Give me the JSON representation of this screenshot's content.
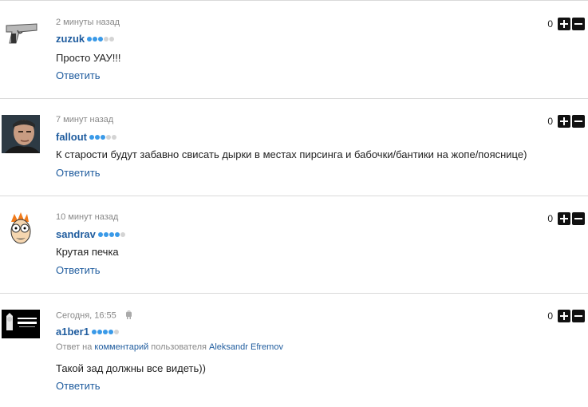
{
  "comments": [
    {
      "time": "2 минуты назад",
      "user": "zuzuk",
      "text": "Просто УАУ!!!",
      "reply": "Ответить",
      "score": "0",
      "avatar": "pistol-avatar"
    },
    {
      "time": "7 минут назад",
      "user": "fallout",
      "text": "К старости будут забавно свисать дырки в местах пирсинга и бабочки/бантики на жопе/пояснице)",
      "reply": "Ответить",
      "score": "0",
      "avatar": "man-photo-avatar"
    },
    {
      "time": "10 минут назад",
      "user": "sandrav",
      "text": "Крутая печка",
      "reply": "Ответить",
      "score": "0",
      "avatar": "cartoon-fry-avatar"
    },
    {
      "time": "Сегодня, 16:55",
      "user": "a1ber1",
      "reply_prefix": "Ответ на",
      "reply_link": "комментарий",
      "reply_middle": "пользователя",
      "reply_user": "Aleksandr Efremov",
      "text": "Такой зад должны все видеть))",
      "reply": "Ответить",
      "score": "0",
      "avatar": "godfather-avatar",
      "device_icon": "android-icon"
    }
  ],
  "colors": {
    "link": "#1f5c9e",
    "muted": "#888888",
    "rank_dot_on": "#3a9ae8",
    "rank_dot_off": "#d4d4d4",
    "separator": "#d9d9d9"
  }
}
